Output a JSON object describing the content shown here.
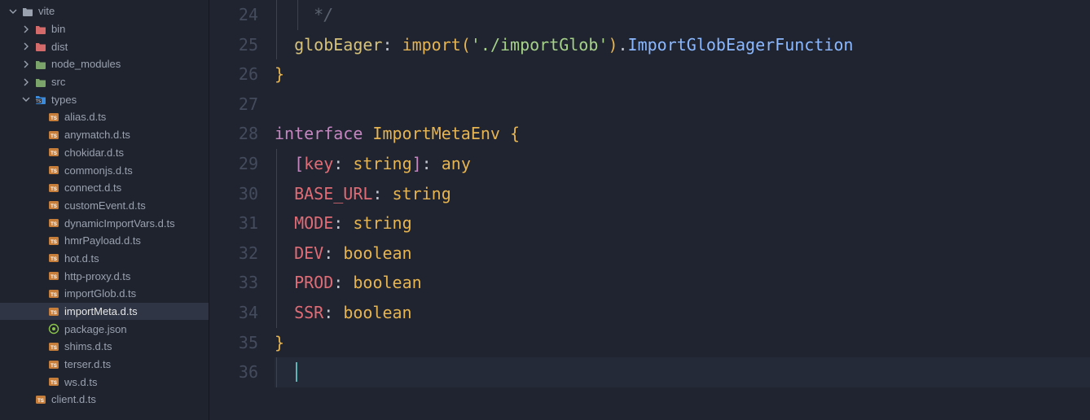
{
  "sidebar": {
    "items": [
      {
        "depth": 0,
        "kind": "folder-open",
        "color": "#9aa1af",
        "chevron": "down",
        "label": "vite"
      },
      {
        "depth": 1,
        "kind": "folder",
        "color": "#d46a6a",
        "chevron": "right",
        "label": "bin"
      },
      {
        "depth": 1,
        "kind": "folder",
        "color": "#d46a6a",
        "chevron": "right",
        "label": "dist"
      },
      {
        "depth": 1,
        "kind": "folder",
        "color": "#7aa46a",
        "chevron": "right",
        "label": "node_modules"
      },
      {
        "depth": 1,
        "kind": "folder",
        "color": "#7aa46a",
        "chevron": "right",
        "label": "src"
      },
      {
        "depth": 1,
        "kind": "folder-ts",
        "color": "#3a8bdb",
        "chevron": "down",
        "label": "types"
      },
      {
        "depth": 2,
        "kind": "ts",
        "color": "#c77e3a",
        "chevron": "",
        "label": "alias.d.ts"
      },
      {
        "depth": 2,
        "kind": "ts",
        "color": "#c77e3a",
        "chevron": "",
        "label": "anymatch.d.ts"
      },
      {
        "depth": 2,
        "kind": "ts",
        "color": "#c77e3a",
        "chevron": "",
        "label": "chokidar.d.ts"
      },
      {
        "depth": 2,
        "kind": "ts",
        "color": "#c77e3a",
        "chevron": "",
        "label": "commonjs.d.ts"
      },
      {
        "depth": 2,
        "kind": "ts",
        "color": "#c77e3a",
        "chevron": "",
        "label": "connect.d.ts"
      },
      {
        "depth": 2,
        "kind": "ts",
        "color": "#c77e3a",
        "chevron": "",
        "label": "customEvent.d.ts"
      },
      {
        "depth": 2,
        "kind": "ts",
        "color": "#c77e3a",
        "chevron": "",
        "label": "dynamicImportVars.d.ts"
      },
      {
        "depth": 2,
        "kind": "ts",
        "color": "#c77e3a",
        "chevron": "",
        "label": "hmrPayload.d.ts"
      },
      {
        "depth": 2,
        "kind": "ts",
        "color": "#c77e3a",
        "chevron": "",
        "label": "hot.d.ts"
      },
      {
        "depth": 2,
        "kind": "ts",
        "color": "#c77e3a",
        "chevron": "",
        "label": "http-proxy.d.ts"
      },
      {
        "depth": 2,
        "kind": "ts",
        "color": "#c77e3a",
        "chevron": "",
        "label": "importGlob.d.ts"
      },
      {
        "depth": 2,
        "kind": "ts",
        "color": "#c77e3a",
        "chevron": "",
        "label": "importMeta.d.ts",
        "selected": true
      },
      {
        "depth": 2,
        "kind": "json",
        "color": "#8bc34a",
        "chevron": "",
        "label": "package.json"
      },
      {
        "depth": 2,
        "kind": "ts",
        "color": "#c77e3a",
        "chevron": "",
        "label": "shims.d.ts"
      },
      {
        "depth": 2,
        "kind": "ts",
        "color": "#c77e3a",
        "chevron": "",
        "label": "terser.d.ts"
      },
      {
        "depth": 2,
        "kind": "ts",
        "color": "#c77e3a",
        "chevron": "",
        "label": "ws.d.ts"
      },
      {
        "depth": 1,
        "kind": "ts",
        "color": "#c77e3a",
        "chevron": "",
        "label": "client.d.ts"
      }
    ]
  },
  "editor": {
    "startLine": 24,
    "lines": [
      {
        "indent": 2,
        "guides": [
          1,
          2
        ],
        "tokens": [
          {
            "t": "*/",
            "c": "com"
          }
        ]
      },
      {
        "indent": 1,
        "guides": [
          1
        ],
        "tokens": [
          {
            "t": "globEager",
            "c": "prop"
          },
          {
            "t": ": ",
            "c": "punc"
          },
          {
            "t": "import",
            "c": "imp"
          },
          {
            "t": "(",
            "c": "par"
          },
          {
            "t": "'./importGlob'",
            "c": "str"
          },
          {
            "t": ")",
            "c": "par"
          },
          {
            "t": ".",
            "c": "punc"
          },
          {
            "t": "ImportGlobEagerFunction",
            "c": "type"
          }
        ]
      },
      {
        "indent": 0,
        "guides": [],
        "tokens": [
          {
            "t": "}",
            "c": "brace"
          }
        ]
      },
      {
        "indent": 0,
        "guides": [],
        "tokens": []
      },
      {
        "indent": 0,
        "guides": [],
        "tokens": [
          {
            "t": "interface",
            "c": "kw"
          },
          {
            "t": " ",
            "c": "punc"
          },
          {
            "t": "ImportMetaEnv",
            "c": "iface"
          },
          {
            "t": " ",
            "c": "punc"
          },
          {
            "t": "{",
            "c": "brace"
          }
        ]
      },
      {
        "indent": 1,
        "guides": [
          1
        ],
        "tokens": [
          {
            "t": "[",
            "c": "brk"
          },
          {
            "t": "key",
            "c": "key"
          },
          {
            "t": ": ",
            "c": "punc"
          },
          {
            "t": "string",
            "c": "prim"
          },
          {
            "t": "]",
            "c": "brk"
          },
          {
            "t": ": ",
            "c": "punc"
          },
          {
            "t": "any",
            "c": "prim"
          }
        ]
      },
      {
        "indent": 1,
        "guides": [
          1
        ],
        "tokens": [
          {
            "t": "BASE_URL",
            "c": "const"
          },
          {
            "t": ": ",
            "c": "punc"
          },
          {
            "t": "string",
            "c": "prim"
          }
        ]
      },
      {
        "indent": 1,
        "guides": [
          1
        ],
        "tokens": [
          {
            "t": "MODE",
            "c": "const"
          },
          {
            "t": ": ",
            "c": "punc"
          },
          {
            "t": "string",
            "c": "prim"
          }
        ]
      },
      {
        "indent": 1,
        "guides": [
          1
        ],
        "tokens": [
          {
            "t": "DEV",
            "c": "const"
          },
          {
            "t": ": ",
            "c": "punc"
          },
          {
            "t": "boolean",
            "c": "prim"
          }
        ]
      },
      {
        "indent": 1,
        "guides": [
          1
        ],
        "tokens": [
          {
            "t": "PROD",
            "c": "const"
          },
          {
            "t": ": ",
            "c": "punc"
          },
          {
            "t": "boolean",
            "c": "prim"
          }
        ]
      },
      {
        "indent": 1,
        "guides": [
          1
        ],
        "tokens": [
          {
            "t": "SSR",
            "c": "const"
          },
          {
            "t": ": ",
            "c": "punc"
          },
          {
            "t": "boolean",
            "c": "prim"
          }
        ]
      },
      {
        "indent": 0,
        "guides": [],
        "tokens": [
          {
            "t": "}",
            "c": "brace"
          }
        ]
      },
      {
        "indent": 1,
        "guides": [
          1
        ],
        "current": true,
        "tokens": []
      }
    ]
  }
}
